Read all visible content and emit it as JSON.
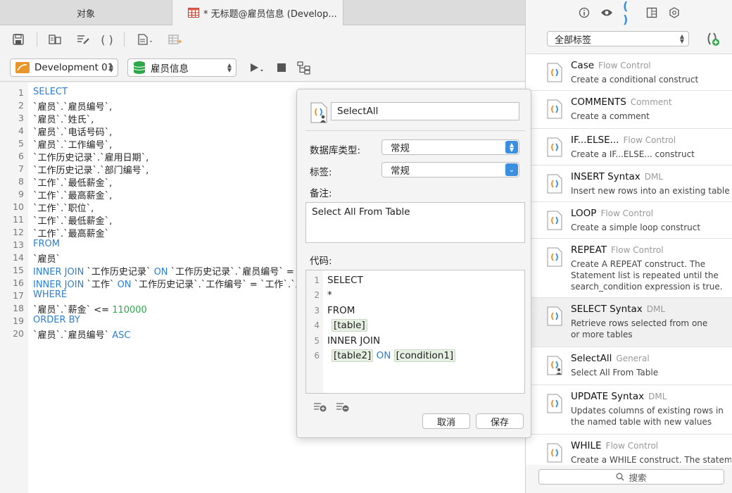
{
  "tabs": {
    "objects": "对象",
    "query": "* 无标题@雇员信息 (Develop..."
  },
  "toolbar": {
    "connection": "Development 01",
    "database": "雇员信息"
  },
  "editor": {
    "line_numbers": [
      "1",
      "2",
      "3",
      "4",
      "5",
      "6",
      "7",
      "8",
      "9",
      "10",
      "11",
      "12",
      "13",
      "14",
      "15",
      "16",
      "17",
      "18",
      "19",
      "20"
    ],
    "lines": [
      {
        "kw": "SELECT",
        "text": ""
      },
      {
        "kw": "",
        "text": "`雇员`.`雇员编号`,"
      },
      {
        "kw": "",
        "text": "`雇员`.`姓氏`,"
      },
      {
        "kw": "",
        "text": "`雇员`.`电话号码`,"
      },
      {
        "kw": "",
        "text": "`雇员`.`工作编号`,"
      },
      {
        "kw": "",
        "text": "`工作历史记录`.`雇用日期`,"
      },
      {
        "kw": "",
        "text": "`工作历史记录`.`部门编号`,"
      },
      {
        "kw": "",
        "text": "`工作`.`最低薪金`,"
      },
      {
        "kw": "",
        "text": "`工作`.`最高薪金`,"
      },
      {
        "kw": "",
        "text": "`工作`.`职位`,"
      },
      {
        "kw": "",
        "text": "`工作`.`最低薪金`,"
      },
      {
        "kw": "",
        "text": "`工作`.`最高薪金`"
      },
      {
        "kw": "FROM",
        "text": ""
      },
      {
        "kw": "",
        "text": "`雇员`"
      },
      {
        "kw": "INNER JOIN",
        "text": " `工作历史记录` ",
        "kw2": "ON",
        "text2": " `工作历史记录`.`雇员编号` = `届"
      },
      {
        "kw": "INNER JOIN",
        "text": " `工作` ",
        "kw2": "ON",
        "text2": " `工作历史记录`.`工作编号` = `工作`.`工"
      },
      {
        "kw": "WHERE",
        "text": ""
      },
      {
        "kw": "",
        "text": "`雇员`.`薪金` <= ",
        "num": "110000"
      },
      {
        "kw": "ORDER BY",
        "text": ""
      },
      {
        "kw": "",
        "text": "`雇员`.`雇员编号` ",
        "kw2": "ASC",
        "text2": ""
      }
    ]
  },
  "popover": {
    "name": "SelectAll",
    "db_type_label": "数据库类型:",
    "db_type_value": "常规",
    "tag_label": "标签:",
    "tag_value": "常规",
    "note_label": "备注:",
    "note": "Select All From Table",
    "code_label": "代码:",
    "code_line_numbers": [
      "1",
      "2",
      "3",
      "4",
      "5",
      "6"
    ],
    "code": {
      "l1": "SELECT",
      "l2": "*",
      "l3": "FROM",
      "l4": "[table]",
      "l5": "INNER JOIN",
      "l6a": "[table2]",
      "l6b": "ON",
      "l6c": "[condition1]"
    },
    "cancel": "取消",
    "save": "保存"
  },
  "right_panel": {
    "filter": "全部标签",
    "search": "搜索",
    "snippets": [
      {
        "title": "Case",
        "category": "Flow Control",
        "desc": "Create a conditional construct"
      },
      {
        "title": "COMMENTS",
        "category": "Comment",
        "desc": "Create a comment"
      },
      {
        "title": "IF...ELSE...",
        "category": "Flow Control",
        "desc": "Create a IF...ELSE... construct"
      },
      {
        "title": "INSERT Syntax",
        "category": "DML",
        "desc": "Insert new rows into an existing table"
      },
      {
        "title": "LOOP",
        "category": "Flow Control",
        "desc": "Create a simple loop construct"
      },
      {
        "title": "REPEAT",
        "category": "Flow Control",
        "desc": "Create A REPEAT construct. The Statement list is repeated until the search_condition expression is true."
      },
      {
        "title": "SELECT Syntax",
        "category": "DML",
        "desc": "Retrieve rows selected from one or more tables"
      },
      {
        "title": "SelectAll",
        "category": "General",
        "desc": "Select All From Table"
      },
      {
        "title": "UPDATE Syntax",
        "category": "DML",
        "desc": "Updates columns of existing rows in the named table with new values"
      },
      {
        "title": "WHILE",
        "category": "Flow Control",
        "desc": "Create a WHILE construct. The statement"
      }
    ]
  },
  "colors": {
    "keyword": "#2d7fd3",
    "number": "#2da84a",
    "accent": "#3b8fe0",
    "snippet_icon_bracket": "#e8962a",
    "snippet_icon_bracket2": "#3b8fe0"
  }
}
